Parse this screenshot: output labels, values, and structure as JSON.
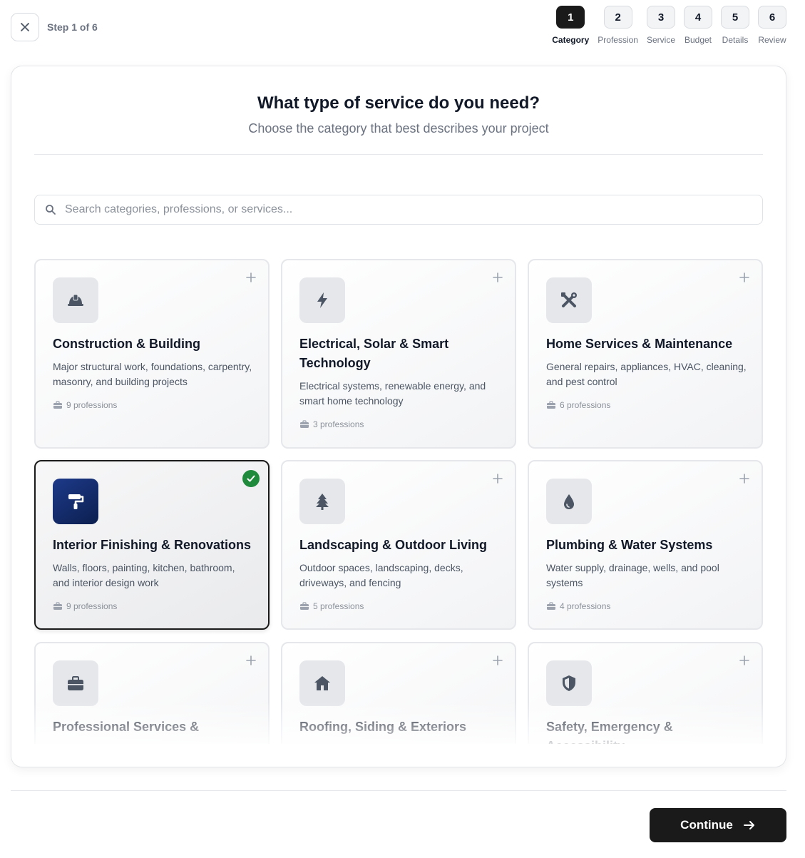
{
  "header": {
    "step_label": "Step 1 of 6",
    "steps": [
      {
        "num": "1",
        "name": "Category",
        "active": true
      },
      {
        "num": "2",
        "name": "Profession"
      },
      {
        "num": "3",
        "name": "Service"
      },
      {
        "num": "4",
        "name": "Budget"
      },
      {
        "num": "5",
        "name": "Details"
      },
      {
        "num": "6",
        "name": "Review"
      }
    ]
  },
  "main": {
    "title": "What type of service do you need?",
    "subtitle": "Choose the category that best describes your project",
    "search_placeholder": "Search categories, professions, or services..."
  },
  "categories": [
    {
      "icon": "hard-hat-icon",
      "title": "Construction & Building",
      "description": "Major structural work, foundations, carpentry, masonry, and building projects",
      "meta": "9 professions"
    },
    {
      "icon": "lightning-bolt-icon",
      "title": "Electrical, Solar & Smart Technology",
      "description": "Electrical systems, renewable energy, and smart home technology",
      "meta": "3 professions"
    },
    {
      "icon": "tools-icon",
      "title": "Home Services & Maintenance",
      "description": "General repairs, appliances, HVAC, cleaning, and pest control",
      "meta": "6 professions"
    },
    {
      "icon": "paint-roller-icon",
      "title": "Interior Finishing & Renovations",
      "description": "Walls, floors, painting, kitchen, bathroom, and interior design work",
      "meta": "9 professions",
      "selected": true
    },
    {
      "icon": "tree-icon",
      "title": "Landscaping & Outdoor Living",
      "description": "Outdoor spaces, landscaping, decks, driveways, and fencing",
      "meta": "5 professions"
    },
    {
      "icon": "water-drop-icon",
      "title": "Plumbing & Water Systems",
      "description": "Water supply, drainage, wells, and pool systems",
      "meta": "4 professions"
    },
    {
      "icon": "briefcase-icon",
      "title": "Professional Services &"
    },
    {
      "icon": "house-icon",
      "title": "Roofing, Siding & Exteriors"
    },
    {
      "icon": "shield-icon",
      "title": "Safety, Emergency & Accessibility"
    }
  ],
  "footer": {
    "continue_label": "Continue"
  },
  "colors": {
    "primary": "#1a1a1a",
    "selected_icon_bg": "#1e3a8a",
    "check_green": "#1f8a3b"
  }
}
